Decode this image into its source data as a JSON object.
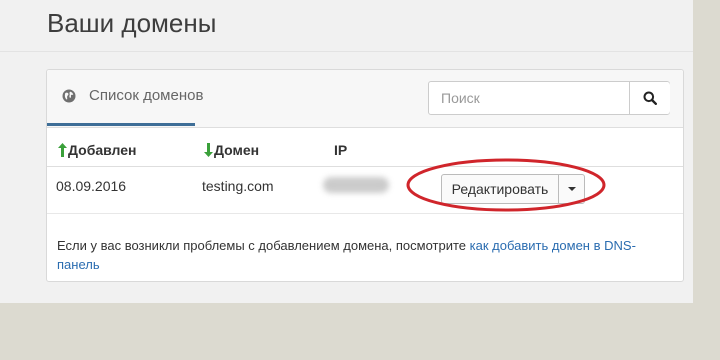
{
  "page": {
    "title": "Ваши домены"
  },
  "panel": {
    "tab_label": "Список доменов",
    "search": {
      "placeholder": "Поиск",
      "value": ""
    }
  },
  "table": {
    "columns": [
      {
        "label": "Добавлен",
        "sort": "up"
      },
      {
        "label": "Домен",
        "sort": "down"
      },
      {
        "label": "IP"
      }
    ],
    "rows": [
      {
        "added": "08.09.2016",
        "domain": "testing.com",
        "ip": "",
        "action_label": "Редактировать"
      }
    ]
  },
  "help": {
    "text": "Если у вас возникли проблемы с добавлением домена, посмотрите ",
    "link_text": "как добавить домен в DNS-панель"
  },
  "colors": {
    "accent": "#3e6e97",
    "link": "#2a6cb0",
    "sort_arrow": "#3aa03a",
    "annotation": "#d0252b"
  },
  "icons": {
    "tab": "globe-icon",
    "search": "search-icon",
    "dropdown": "caret-down-icon",
    "sort_up": "arrow-up-icon",
    "sort_down": "arrow-down-icon"
  }
}
